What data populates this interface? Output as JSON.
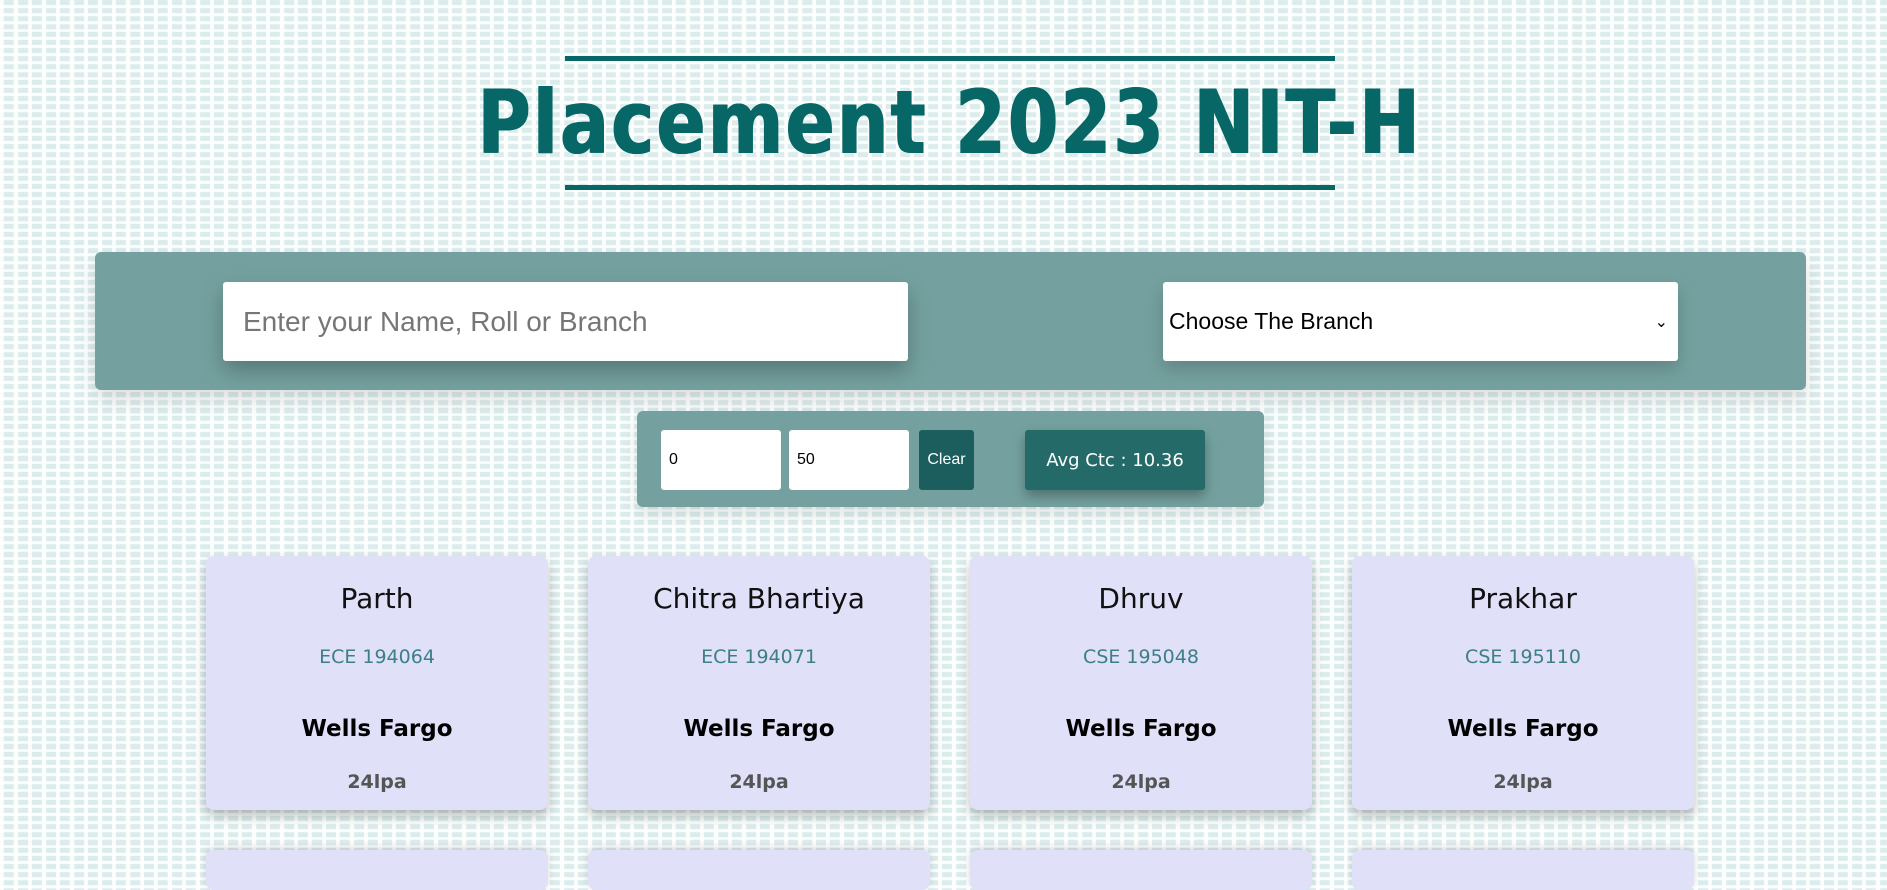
{
  "header": {
    "title": "Placement 2023 NIT-H"
  },
  "search": {
    "placeholder": "Enter your Name, Roll or Branch",
    "branch_select": "Choose The Branch"
  },
  "filter": {
    "min_value": "0",
    "max_value": "50",
    "clear_label": "Clear",
    "avg_label": "Avg Ctc : 10.36"
  },
  "cards": [
    {
      "name": "Parth",
      "roll": "ECE 194064",
      "company": "Wells Fargo",
      "ctc": "24lpa"
    },
    {
      "name": "Chitra Bhartiya",
      "roll": "ECE 194071",
      "company": "Wells Fargo",
      "ctc": "24lpa"
    },
    {
      "name": "Dhruv",
      "roll": "CSE 195048",
      "company": "Wells Fargo",
      "ctc": "24lpa"
    },
    {
      "name": "Prakhar",
      "roll": "CSE 195110",
      "company": "Wells Fargo",
      "ctc": "24lpa"
    }
  ],
  "colors": {
    "primary": "#076766",
    "panel": "#74a19f",
    "card": "#e0e0f9",
    "roll_text": "#3c7f87"
  }
}
